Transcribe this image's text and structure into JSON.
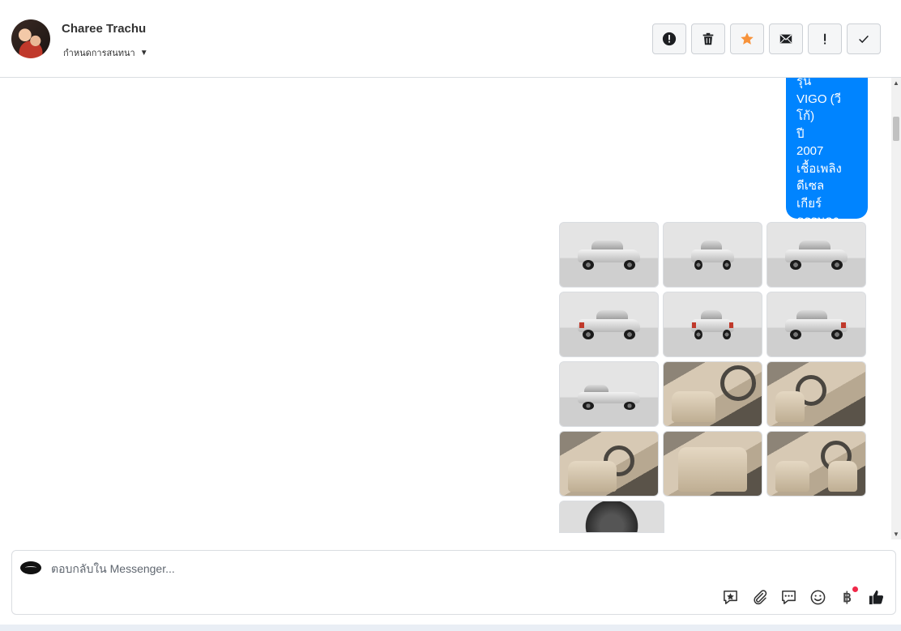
{
  "header": {
    "contact_name": "Charee Trachu",
    "assign_label": "กำหนดการสนทนา",
    "actions": [
      {
        "name": "spam-button",
        "icon": "alert-circle-icon"
      },
      {
        "name": "delete-button",
        "icon": "trash-icon"
      },
      {
        "name": "star-button",
        "icon": "star-icon"
      },
      {
        "name": "mark-unread-button",
        "icon": "envelope-icon"
      },
      {
        "name": "important-button",
        "icon": "exclamation-icon"
      },
      {
        "name": "done-button",
        "icon": "check-icon"
      }
    ]
  },
  "message": {
    "lines": [
      "รุ่น",
      "VIGO (วีโก้)",
      "ปี",
      "2007",
      "เชื้อเพลิง",
      "ดีเซล",
      "เกียร์",
      "ธรรมดา"
    ]
  },
  "photos": [
    {
      "kind": "exterior-front-left"
    },
    {
      "kind": "exterior-front"
    },
    {
      "kind": "exterior-front-right"
    },
    {
      "kind": "exterior-rear-left"
    },
    {
      "kind": "exterior-rear"
    },
    {
      "kind": "exterior-rear-right"
    },
    {
      "kind": "exterior-side"
    },
    {
      "kind": "interior-console"
    },
    {
      "kind": "interior-dashboard"
    },
    {
      "kind": "interior-front-seat"
    },
    {
      "kind": "interior-rear-seat"
    },
    {
      "kind": "interior-cabin"
    },
    {
      "kind": "engine-bay"
    }
  ],
  "composer": {
    "placeholder": "ตอบกลับใน Messenger...",
    "tools": [
      "saved-reply-icon",
      "paperclip-icon",
      "chat-bubble-icon",
      "smiley-icon",
      "baht-icon",
      "thumbs-up-icon"
    ],
    "baht_symbol": "฿"
  },
  "colors": {
    "bubble": "#0084ff",
    "star": "#f7923a",
    "notification_dot": "#f02849"
  }
}
